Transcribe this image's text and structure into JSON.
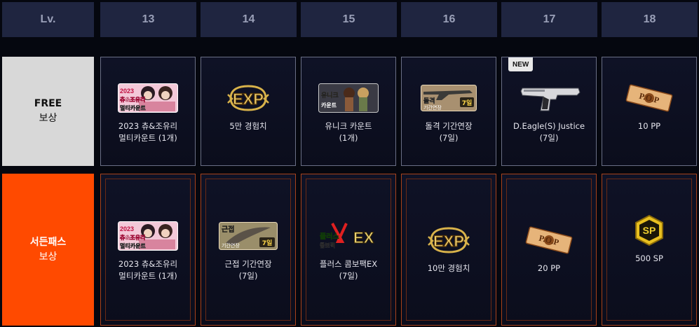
{
  "header": {
    "lv_label": "Lv.",
    "levels": [
      "13",
      "14",
      "15",
      "16",
      "17",
      "18"
    ]
  },
  "rows": {
    "free": {
      "line1": "FREE",
      "line2": "보상"
    },
    "pass": {
      "line1": "서든패스",
      "line2": "보상"
    }
  },
  "free_rewards": [
    {
      "icon": "character-card-icon",
      "img_text1": "2023",
      "img_text2": "츄&조유리",
      "img_text3": "멀티카운트",
      "name1": "2023 츄&조유리",
      "name2": "멀티카운트 (1개)"
    },
    {
      "icon": "exp-icon",
      "img_text1": "EXP",
      "name1": "5만 경험치",
      "name2": ""
    },
    {
      "icon": "unique-count-icon",
      "img_text1": "유니크",
      "img_text2": "카운트",
      "name1": "유니크 카운트",
      "name2": "(1개)"
    },
    {
      "icon": "rifle-period-icon",
      "img_text1": "돌격",
      "img_text2": "기간연장",
      "img_text3": "7일",
      "name1": "돌격 기간연장",
      "name2": "(7일)"
    },
    {
      "icon": "pistol-icon",
      "badge": "NEW",
      "name1": "D.Eagle(S) Justice",
      "name2": "(7일)"
    },
    {
      "icon": "pop-ticket-icon",
      "img_text1": "P.O.P",
      "name1": "10 PP",
      "name2": ""
    }
  ],
  "pass_rewards": [
    {
      "icon": "character-card-icon",
      "img_text1": "2023",
      "img_text2": "츄&조유리",
      "img_text3": "멀티카운트",
      "name1": "2023 츄&조유리",
      "name2": "멀티카운트 (1개)"
    },
    {
      "icon": "melee-period-icon",
      "img_text1": "근접",
      "img_text2": "기간연장",
      "img_text3": "7일",
      "name1": "근접 기간연장",
      "name2": "(7일)"
    },
    {
      "icon": "plus-combo-box-icon",
      "img_text1": "플러스",
      "img_text2": "콤보팩",
      "img_text3": "EX",
      "name1": "플러스 콤보팩EX",
      "name2": "(7일)"
    },
    {
      "icon": "exp-icon",
      "img_text1": "EXP",
      "name1": "10만 경험치",
      "name2": ""
    },
    {
      "icon": "pop-ticket-icon",
      "img_text1": "P.O.P",
      "name1": "20 PP",
      "name2": ""
    },
    {
      "icon": "sp-coin-icon",
      "img_text1": "SP",
      "name1": "500 SP",
      "name2": ""
    }
  ],
  "colors": {
    "header_bg": "#1f2540",
    "free_label_bg": "#d8d8d8",
    "pass_label_bg": "#ff4a00",
    "cell_bg": "#0f1226",
    "gold": "#d8b24a"
  }
}
